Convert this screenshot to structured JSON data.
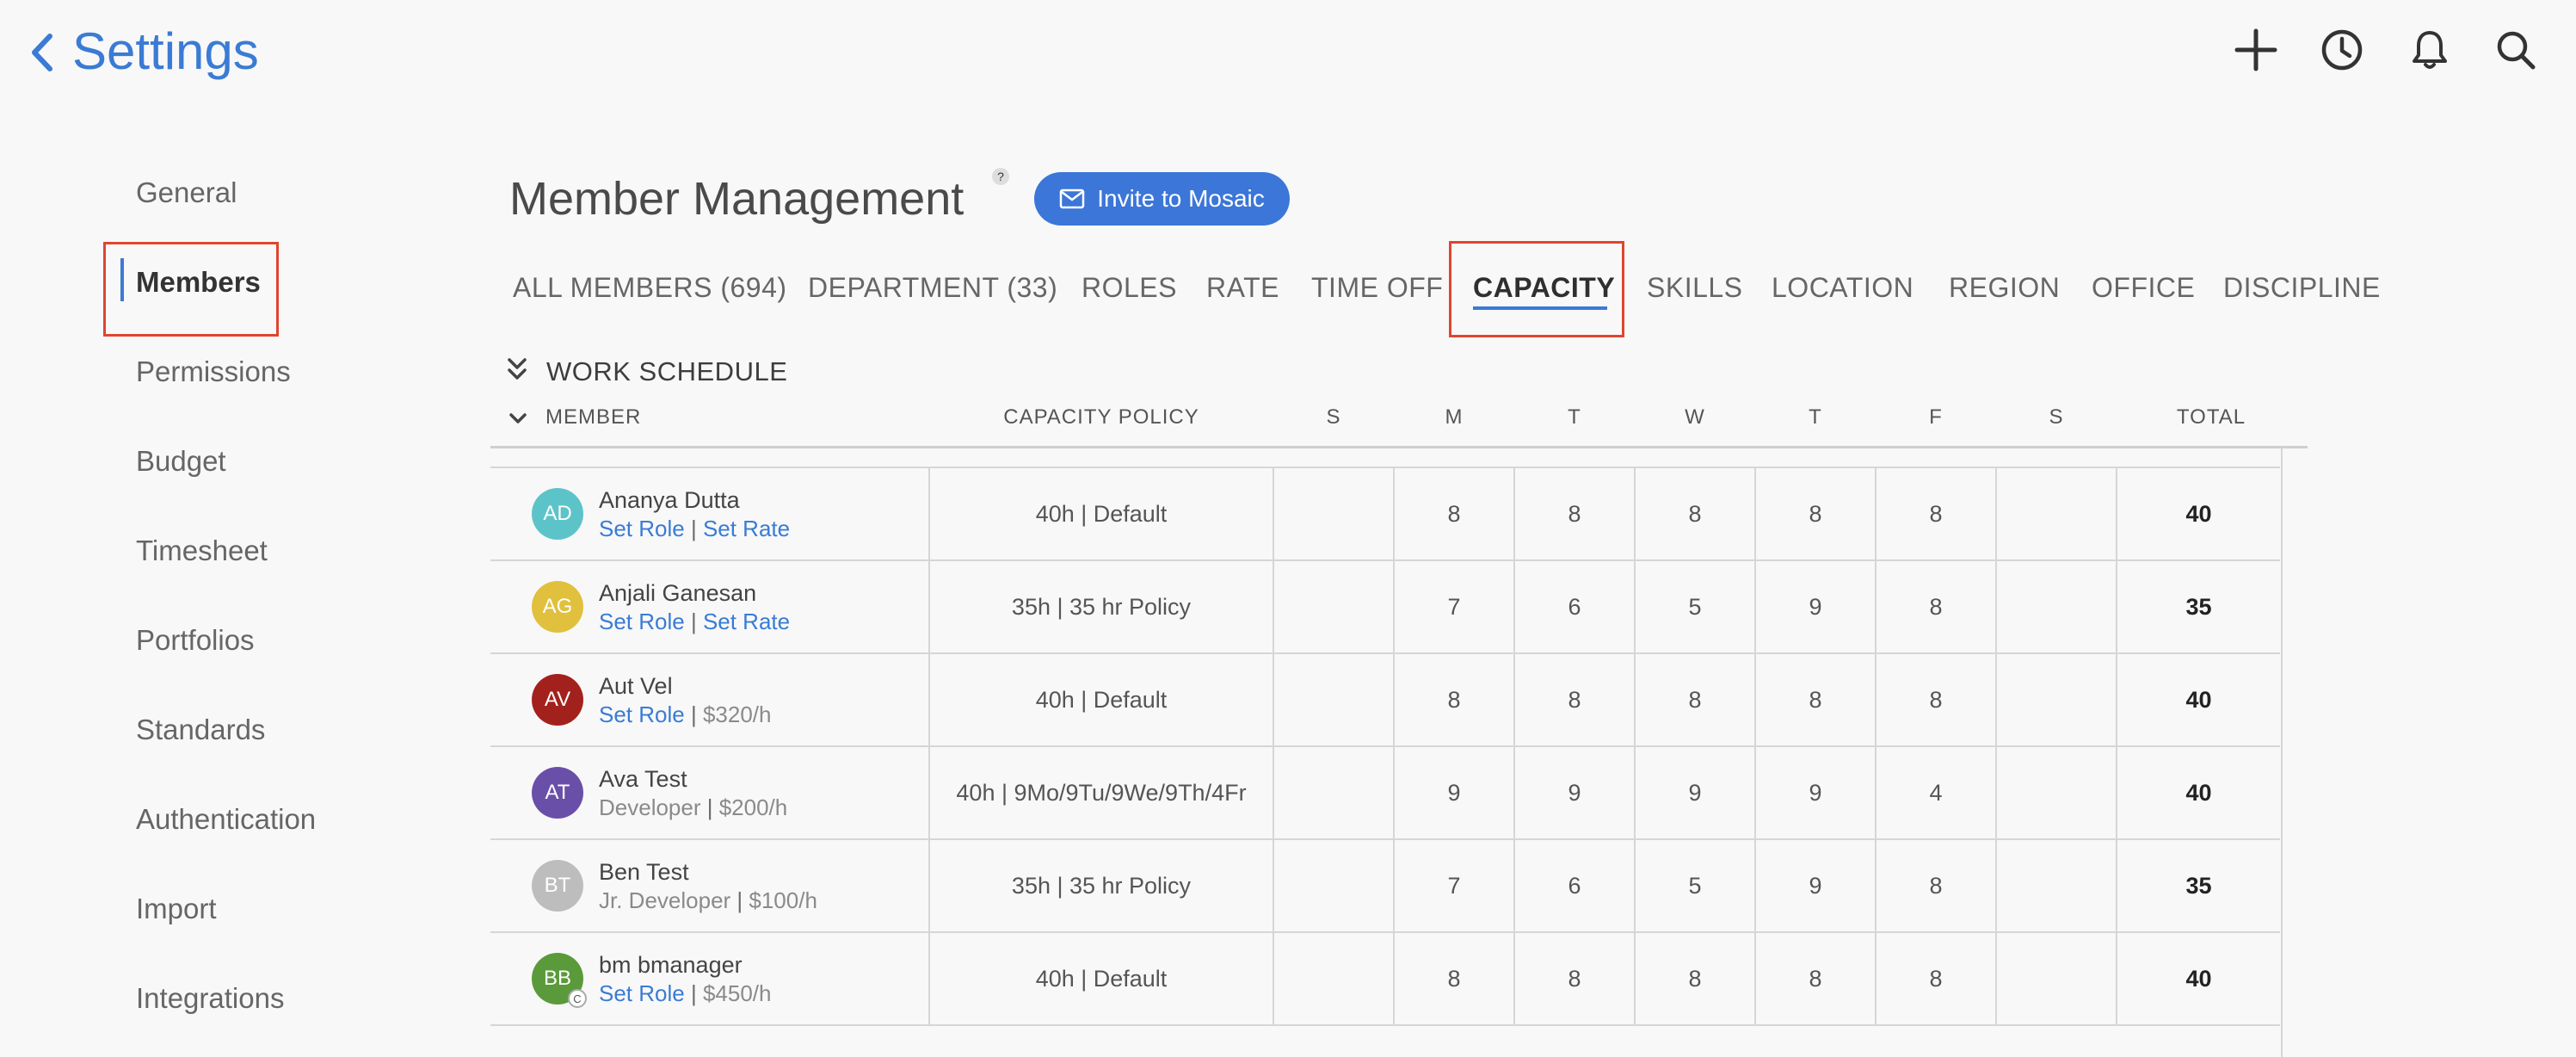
{
  "header": {
    "title": "Settings",
    "icons": [
      "plus-icon",
      "clock-icon",
      "bell-icon",
      "search-icon"
    ]
  },
  "sidebar": {
    "items": [
      {
        "label": "General"
      },
      {
        "label": "Members",
        "active": true
      },
      {
        "label": "Permissions"
      },
      {
        "label": "Budget"
      },
      {
        "label": "Timesheet"
      },
      {
        "label": "Portfolios"
      },
      {
        "label": "Standards"
      },
      {
        "label": "Authentication"
      },
      {
        "label": "Import"
      },
      {
        "label": "Integrations"
      }
    ]
  },
  "main": {
    "title": "Member Management",
    "help": "?",
    "invite_label": "Invite to Mosaic",
    "tabs": [
      {
        "label": "ALL MEMBERS (694)"
      },
      {
        "label": "DEPARTMENT (33)"
      },
      {
        "label": "ROLES"
      },
      {
        "label": "RATE"
      },
      {
        "label": "TIME OFF"
      },
      {
        "label": "CAPACITY",
        "active": true
      },
      {
        "label": "SKILLS"
      },
      {
        "label": "LOCATION"
      },
      {
        "label": "REGION"
      },
      {
        "label": "OFFICE"
      },
      {
        "label": "DISCIPLINE"
      }
    ],
    "section_title": "WORK SCHEDULE",
    "columns": {
      "member": "MEMBER",
      "policy": "CAPACITY POLICY",
      "days": [
        "S",
        "M",
        "T",
        "W",
        "T",
        "F",
        "S"
      ],
      "total": "TOTAL"
    },
    "rows": [
      {
        "initials": "AD",
        "color": "#5cc4c9",
        "name": "Ananya Dutta",
        "role": "Set Role",
        "role_link": true,
        "rate": "Set Rate",
        "rate_link": true,
        "policy": "40h | Default",
        "days": [
          "",
          "8",
          "8",
          "8",
          "8",
          "8",
          ""
        ],
        "total": "40"
      },
      {
        "initials": "AG",
        "color": "#e0c03c",
        "name": "Anjali Ganesan",
        "role": "Set Role",
        "role_link": true,
        "rate": "Set Rate",
        "rate_link": true,
        "policy": "35h | 35 hr Policy",
        "days": [
          "",
          "7",
          "6",
          "5",
          "9",
          "8",
          ""
        ],
        "total": "35"
      },
      {
        "initials": "AV",
        "color": "#a3211c",
        "name": "Aut Vel",
        "role": "Set Role",
        "role_link": true,
        "rate": "$320/h",
        "rate_link": false,
        "policy": "40h | Default",
        "days": [
          "",
          "8",
          "8",
          "8",
          "8",
          "8",
          ""
        ],
        "total": "40"
      },
      {
        "initials": "AT",
        "color": "#6a4fa8",
        "name": "Ava Test",
        "role": "Developer",
        "role_link": false,
        "rate": "$200/h",
        "rate_link": false,
        "policy": "40h | 9Mo/9Tu/9We/9Th/4Fr",
        "days": [
          "",
          "9",
          "9",
          "9",
          "9",
          "4",
          ""
        ],
        "total": "40"
      },
      {
        "initials": "BT",
        "color": "#bdbdbd",
        "name": "Ben Test",
        "role": "Jr. Developer",
        "role_link": false,
        "rate": "$100/h",
        "rate_link": false,
        "policy": "35h | 35 hr Policy",
        "days": [
          "",
          "7",
          "6",
          "5",
          "9",
          "8",
          ""
        ],
        "total": "35"
      },
      {
        "initials": "BB",
        "color": "#5a9a3a",
        "name": "bm bmanager",
        "role": "Set Role",
        "role_link": true,
        "rate": "$450/h",
        "rate_link": false,
        "policy": "40h | Default",
        "days": [
          "",
          "8",
          "8",
          "8",
          "8",
          "8",
          ""
        ],
        "total": "40",
        "badge": "C"
      }
    ]
  },
  "colors": {
    "accent": "#3a7bd5",
    "highlight": "#e0452f"
  }
}
